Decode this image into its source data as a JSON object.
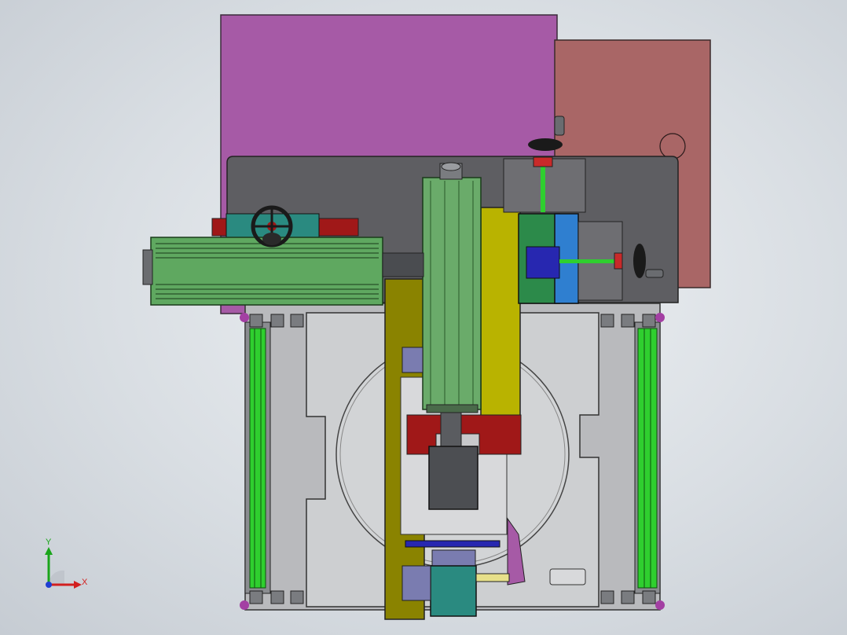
{
  "triad": {
    "y_label": "Y",
    "x_label": "X",
    "y_color": "#1aa51a",
    "x_color": "#d21f1f",
    "z_color": "#1f3fd2"
  },
  "palette": {
    "background": "#dde2e7",
    "back_plate": "#a65aa6",
    "side_plate": "#a96666",
    "dark_plate": "#5e5e62",
    "base": "#c9cacc",
    "column": "#6aab6a",
    "column_gold": "#b9b300",
    "motor": "#5fa860",
    "rail": "#2fcf2f",
    "bracket_red": "#a01818",
    "blue_block": "#2f7fd0",
    "teal_block": "#2a8a80",
    "navy": "#2727b0",
    "handwheel": "#1a1a1a"
  }
}
